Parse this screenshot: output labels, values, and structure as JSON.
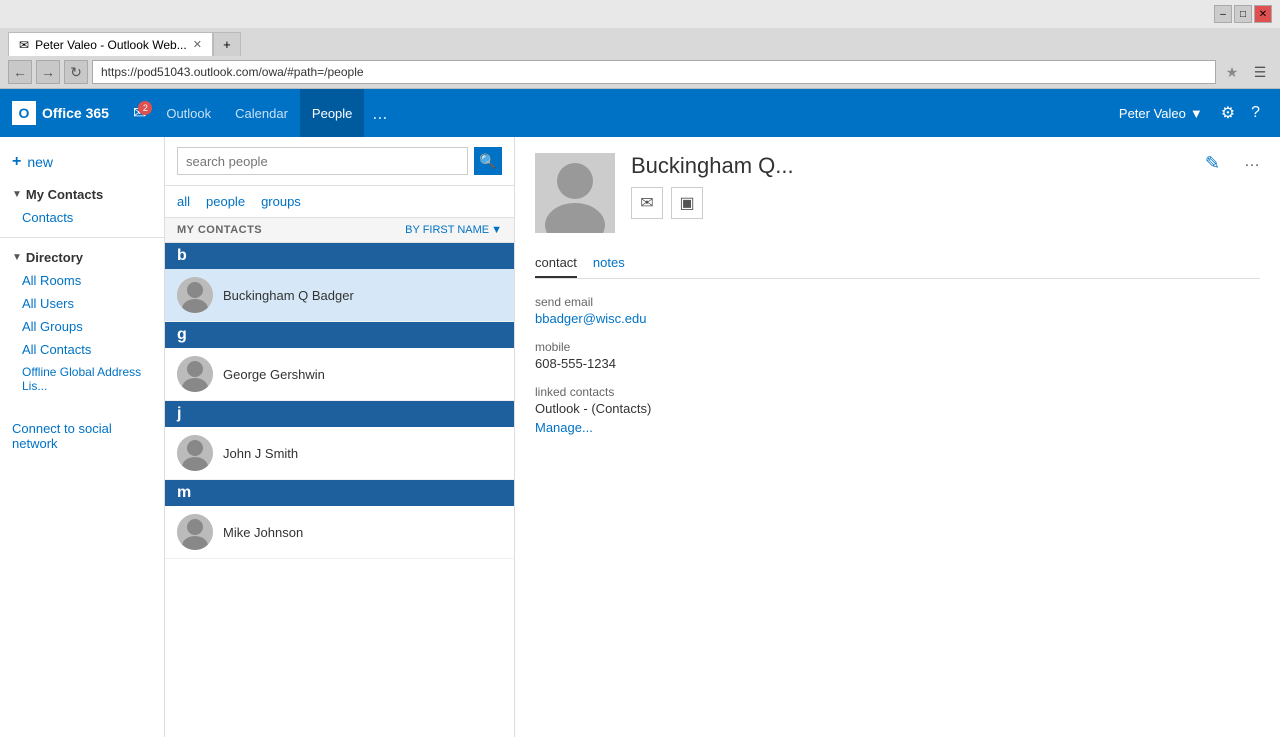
{
  "browser": {
    "tab_title": "Peter Valeo - Outlook Web...",
    "address": "https://pod51043.outlook.com/owa/#path=/people",
    "favicon": "✉"
  },
  "topnav": {
    "brand": "Office 365",
    "mail_badge": "2",
    "links": [
      {
        "label": "Outlook",
        "active": false
      },
      {
        "label": "Calendar",
        "active": false
      },
      {
        "label": "People",
        "active": true
      }
    ],
    "more": "...",
    "user": "Peter Valeo",
    "settings_icon": "⚙",
    "help_icon": "?"
  },
  "sidebar": {
    "new_label": "new",
    "sections": [
      {
        "label": "My Contacts",
        "items": [
          {
            "label": "Contacts",
            "selected": false
          }
        ]
      },
      {
        "label": "Directory",
        "items": [
          {
            "label": "All Rooms",
            "selected": false
          },
          {
            "label": "All Users",
            "selected": false
          },
          {
            "label": "All Groups",
            "selected": false
          },
          {
            "label": "All Contacts",
            "selected": false
          },
          {
            "label": "Offline Global Address Lis...",
            "selected": false
          }
        ]
      }
    ],
    "connect_social": "Connect to social network"
  },
  "contact_list": {
    "search_placeholder": "search people",
    "filter_tabs": [
      {
        "label": "all",
        "active": false
      },
      {
        "label": "people",
        "active": false
      },
      {
        "label": "groups",
        "active": false
      }
    ],
    "header_label": "MY CONTACTS",
    "sort_label": "BY FIRST NAME",
    "groups": [
      {
        "letter": "b",
        "contacts": [
          {
            "name": "Buckingham Q Badger",
            "selected": true
          }
        ]
      },
      {
        "letter": "g",
        "contacts": [
          {
            "name": "George Gershwin",
            "selected": false
          }
        ]
      },
      {
        "letter": "j",
        "contacts": [
          {
            "name": "John J Smith",
            "selected": false
          }
        ]
      },
      {
        "letter": "m",
        "contacts": [
          {
            "name": "Mike Johnson",
            "selected": false
          }
        ]
      }
    ]
  },
  "detail": {
    "name": "Buckingham Q...",
    "tabs": [
      {
        "label": "contact",
        "active": true
      },
      {
        "label": "notes",
        "active": false
      }
    ],
    "fields": [
      {
        "label": "send email",
        "value": "bbadger@wisc.edu",
        "link": true
      },
      {
        "label": "mobile",
        "value": "608-555-1234",
        "link": false
      },
      {
        "label": "linked contacts",
        "value": "Outlook - (Contacts)",
        "link": false
      },
      {
        "label": "manage_link",
        "value": "Manage...",
        "link": true
      }
    ]
  }
}
